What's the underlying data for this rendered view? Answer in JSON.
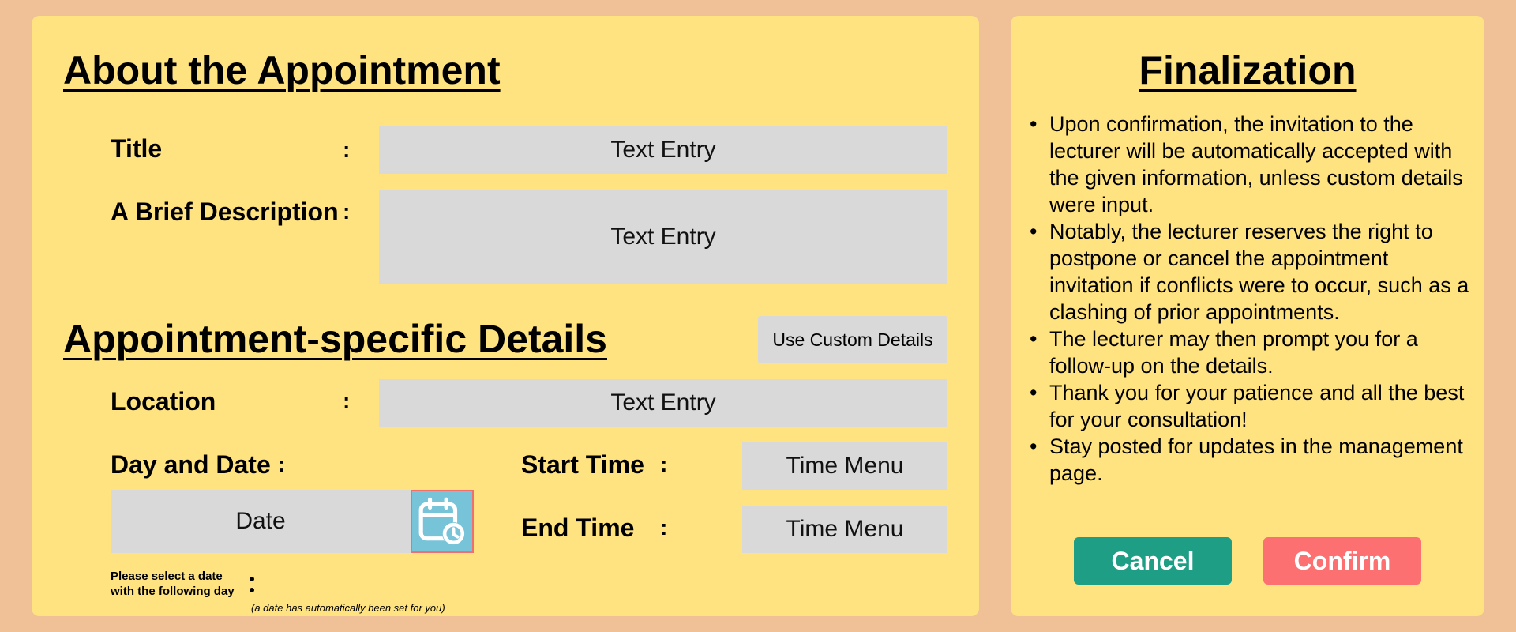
{
  "about": {
    "heading": "About the Appointment",
    "title_label": "Title",
    "title_value": "Text Entry",
    "description_label": "A Brief Description",
    "description_value": "Text Entry"
  },
  "details": {
    "heading": "Appointment-specific Details",
    "custom_button": "Use Custom Details",
    "location_label": "Location",
    "location_value": "Text Entry",
    "day_date_label": "Day and Date",
    "date_value": "Date",
    "calendar_icon": "calendar-clock-icon",
    "start_time_label": "Start Time",
    "start_time_value": "Time Menu",
    "end_time_label": "End Time",
    "end_time_value": "Time Menu",
    "date_note_line1": "Please select a date",
    "date_note_line2": "with the following day",
    "date_auto_note": "(a date has automatically been set for you)"
  },
  "colon": ":",
  "finalization": {
    "heading": "Finalization",
    "items": [
      "Upon confirmation, the invitation to the lecturer will be automatically accepted with the given information, unless custom details were input.",
      "Notably, the lecturer reserves the right to postpone or cancel the appointment invitation if conflicts were to occur, such as a clashing of prior appointments.",
      "The lecturer may then prompt you for a follow-up on the details.",
      "Thank you for your patience and all the best for your consultation!",
      "Stay posted for updates in the management page."
    ],
    "cancel_label": "Cancel",
    "confirm_label": "Confirm"
  },
  "colors": {
    "background": "#F0C196",
    "panel": "#FFE380",
    "field": "#D9D9D9",
    "calendar_button": "#77C3D8",
    "cancel_button": "#1D9E85",
    "confirm_button": "#FD7072"
  }
}
